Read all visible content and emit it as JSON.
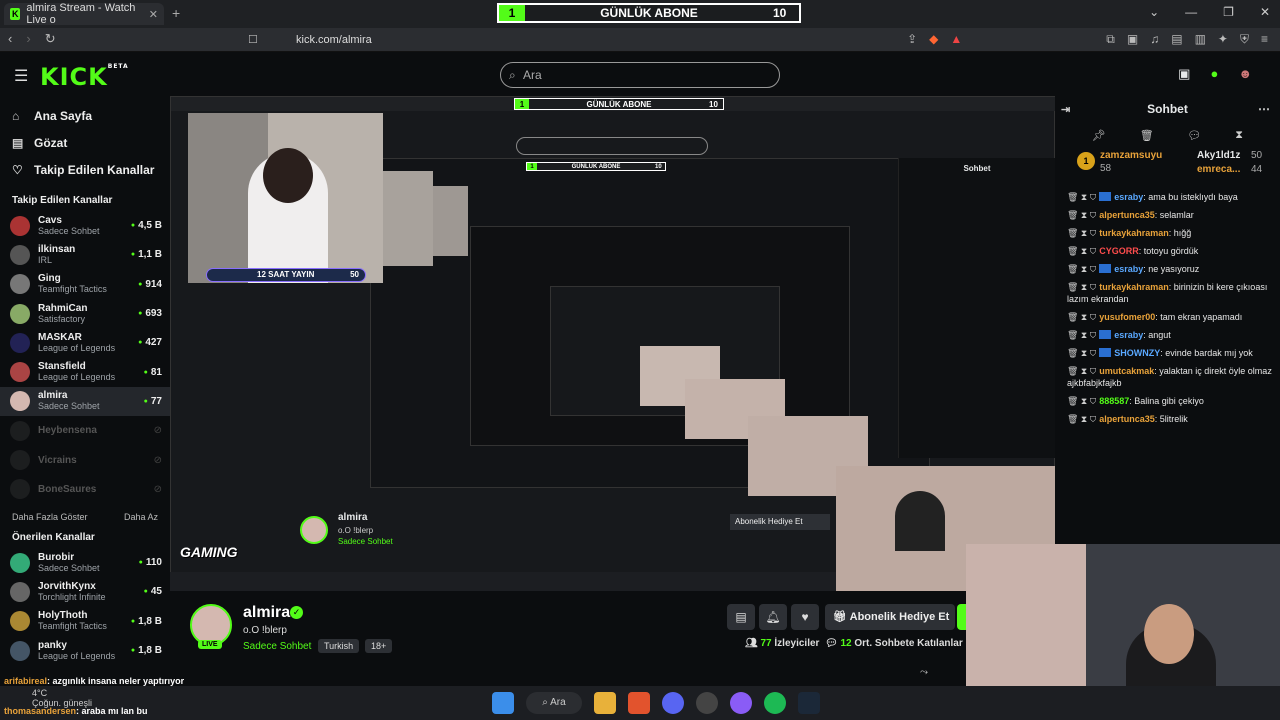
{
  "browser": {
    "tab_title": "almira Stream - Watch Live o",
    "url": "kick.com/almira"
  },
  "sub_widget": {
    "count_left": "1",
    "label": "GÜNLÜK ABONE",
    "count_right": "10"
  },
  "header": {
    "logo": "KICK",
    "logo_beta": "BETA",
    "search_placeholder": "Ara"
  },
  "sidebar": {
    "nav": [
      {
        "label": "Ana Sayfa",
        "icon": "home-icon"
      },
      {
        "label": "Gözat",
        "icon": "browse-icon"
      },
      {
        "label": "Takip Edilen Kanallar",
        "icon": "heart-icon"
      }
    ],
    "followed_heading": "Takip Edilen Kanallar",
    "followed": [
      {
        "name": "Cavs",
        "sub": "Sadece Sohbet",
        "viewers": "4,5 B",
        "color": "#a33"
      },
      {
        "name": "ilkinsan",
        "sub": "IRL",
        "viewers": "1,1 B",
        "color": "#555"
      },
      {
        "name": "Ging",
        "sub": "Teamfight Tactics",
        "viewers": "914",
        "color": "#777"
      },
      {
        "name": "RahmiCan",
        "sub": "Satisfactory",
        "viewers": "693",
        "color": "#8a6"
      },
      {
        "name": "MASKAR",
        "sub": "League of Legends",
        "viewers": "427",
        "color": "#225"
      },
      {
        "name": "Stansfield",
        "sub": "League of Legends",
        "viewers": "81",
        "color": "#a44"
      },
      {
        "name": "almira",
        "sub": "Sadece Sohbet",
        "viewers": "77",
        "color": "#d4b8b0",
        "active": true
      }
    ],
    "offline": [
      {
        "name": "Heybensena"
      },
      {
        "name": "Vicrains"
      },
      {
        "name": "BoneSaures"
      }
    ],
    "more": "Daha Fazla Göster",
    "less": "Daha Az",
    "suggested_heading": "Önerilen Kanallar",
    "suggested": [
      {
        "name": "Burobir",
        "sub": "Sadece Sohbet",
        "viewers": "110",
        "color": "#3a7"
      },
      {
        "name": "JorvithKynx",
        "sub": "Torchlight Infinite",
        "viewers": "45",
        "color": "#666"
      },
      {
        "name": "HolyThoth",
        "sub": "Teamfight Tactics",
        "viewers": "1,8 B",
        "color": "#a83"
      },
      {
        "name": "panky",
        "sub": "League of Legends",
        "viewers": "1,8 B",
        "color": "#456"
      }
    ]
  },
  "stream_overlay": {
    "banner": "12 SAAT YAYIN",
    "banner_num": "50",
    "gaming": "GAMING"
  },
  "channel": {
    "name": "almira",
    "title": "o.O !blerp",
    "category": "Sadece Sohbet",
    "tags": [
      "Turkish",
      "18+"
    ],
    "live": "LIVE",
    "gift_label": "Abonelik Hediye Et",
    "viewers_num": "77",
    "viewers_label": "İzleyiciler",
    "participants_num": "12",
    "participants_label": "Ort. Sohbete Katılanlar"
  },
  "chat": {
    "title": "Sohbet",
    "pinned": {
      "user1": "zamzamsuyu",
      "num1": "58",
      "user2": "Aky1ld1z",
      "num2": "50",
      "user3": "emreca...",
      "num3": "44"
    },
    "messages": [
      {
        "user": "esraby",
        "color": "#5aa8ff",
        "text": "ama bu isteklıydı baya",
        "badge": true
      },
      {
        "user": "alpertunca35",
        "color": "#e8a23a",
        "text": "selamlar"
      },
      {
        "user": "turkaykahraman",
        "color": "#e8a23a",
        "text": "hığğ"
      },
      {
        "user": "CYGORR",
        "color": "#ff4d4d",
        "text": "totoyu gördük"
      },
      {
        "user": "esraby",
        "color": "#5aa8ff",
        "text": "ne yasıyoruz",
        "badge": true
      },
      {
        "user": "turkaykahraman",
        "color": "#e8a23a",
        "text": "birinizin bi kere çıkıoası lazım ekrandan"
      },
      {
        "user": "yusufomer00",
        "color": "#e8a23a",
        "text": "tam ekran yapamadı"
      },
      {
        "user": "esraby",
        "color": "#5aa8ff",
        "text": "angut",
        "badge": true
      },
      {
        "user": "SHOWNZY",
        "color": "#5aa8ff",
        "text": "evinde bardak mıj yok",
        "badge": true
      },
      {
        "user": "umutcakmak",
        "color": "#e8a23a",
        "text": "yalaktan iç direkt öyle olmaz ajkbfabjkfajkb"
      },
      {
        "user": "888587",
        "color": "#53fc18",
        "text": "Balina gibi çekiyo"
      },
      {
        "user": "alpertunca35",
        "color": "#e8a23a",
        "text": "5litrelik"
      }
    ]
  },
  "ticker": {
    "line1_user": "arifabireal",
    "line1_text": ": azgınlık insana neler yaptırıyor",
    "line2_user": "thomasandersen",
    "line2_text": ": araba mı lan bu"
  },
  "taskbar": {
    "search": "Ara",
    "weather": "4°C",
    "weather_sub": "Çoğun. güneşli"
  }
}
